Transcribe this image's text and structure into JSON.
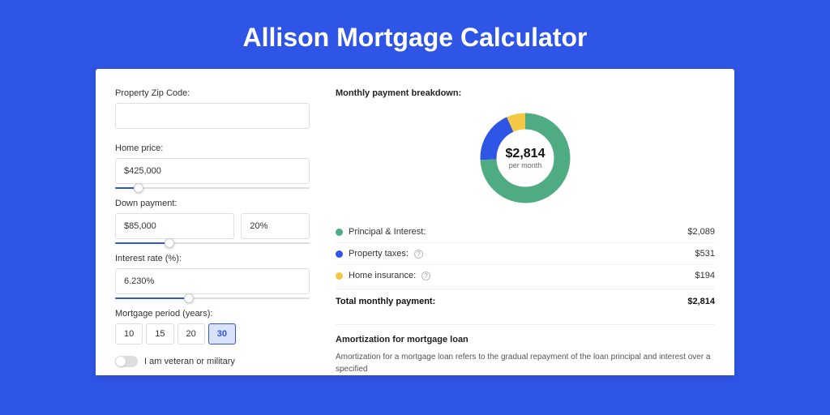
{
  "title": "Allison Mortgage Calculator",
  "form": {
    "zip_label": "Property Zip Code:",
    "zip_value": "",
    "price_label": "Home price:",
    "price_value": "$425,000",
    "price_pct": "12%",
    "down_label": "Down payment:",
    "down_value": "$85,000",
    "down_pct_value": "20%",
    "down_slider_pct": "28%",
    "rate_label": "Interest rate (%):",
    "rate_value": "6.230%",
    "rate_slider_pct": "38%",
    "period_label": "Mortgage period (years):",
    "periods": [
      "10",
      "15",
      "20",
      "30"
    ],
    "period_active_index": 3,
    "veteran_label": "I am veteran or military"
  },
  "breakdown": {
    "title": "Monthly payment breakdown:",
    "center_amount": "$2,814",
    "center_sub": "per month",
    "items": [
      {
        "label": "Principal & Interest:",
        "value": "$2,089",
        "color": "#4fac82",
        "info": false
      },
      {
        "label": "Property taxes:",
        "value": "$531",
        "color": "#2f55e6",
        "info": true
      },
      {
        "label": "Home insurance:",
        "value": "$194",
        "color": "#f4c844",
        "info": true
      }
    ],
    "total_label": "Total monthly payment:",
    "total_value": "$2,814"
  },
  "amort": {
    "title": "Amortization for mortgage loan",
    "body": "Amortization for a mortgage loan refers to the gradual repayment of the loan principal and interest over a specified"
  },
  "chart_data": {
    "type": "pie",
    "title": "Monthly payment breakdown",
    "series": [
      {
        "name": "Principal & Interest",
        "value": 2089,
        "color": "#4fac82"
      },
      {
        "name": "Property taxes",
        "value": 531,
        "color": "#2f55e6"
      },
      {
        "name": "Home insurance",
        "value": 194,
        "color": "#f4c844"
      }
    ],
    "total": 2814,
    "center_label": "$2,814 per month"
  }
}
